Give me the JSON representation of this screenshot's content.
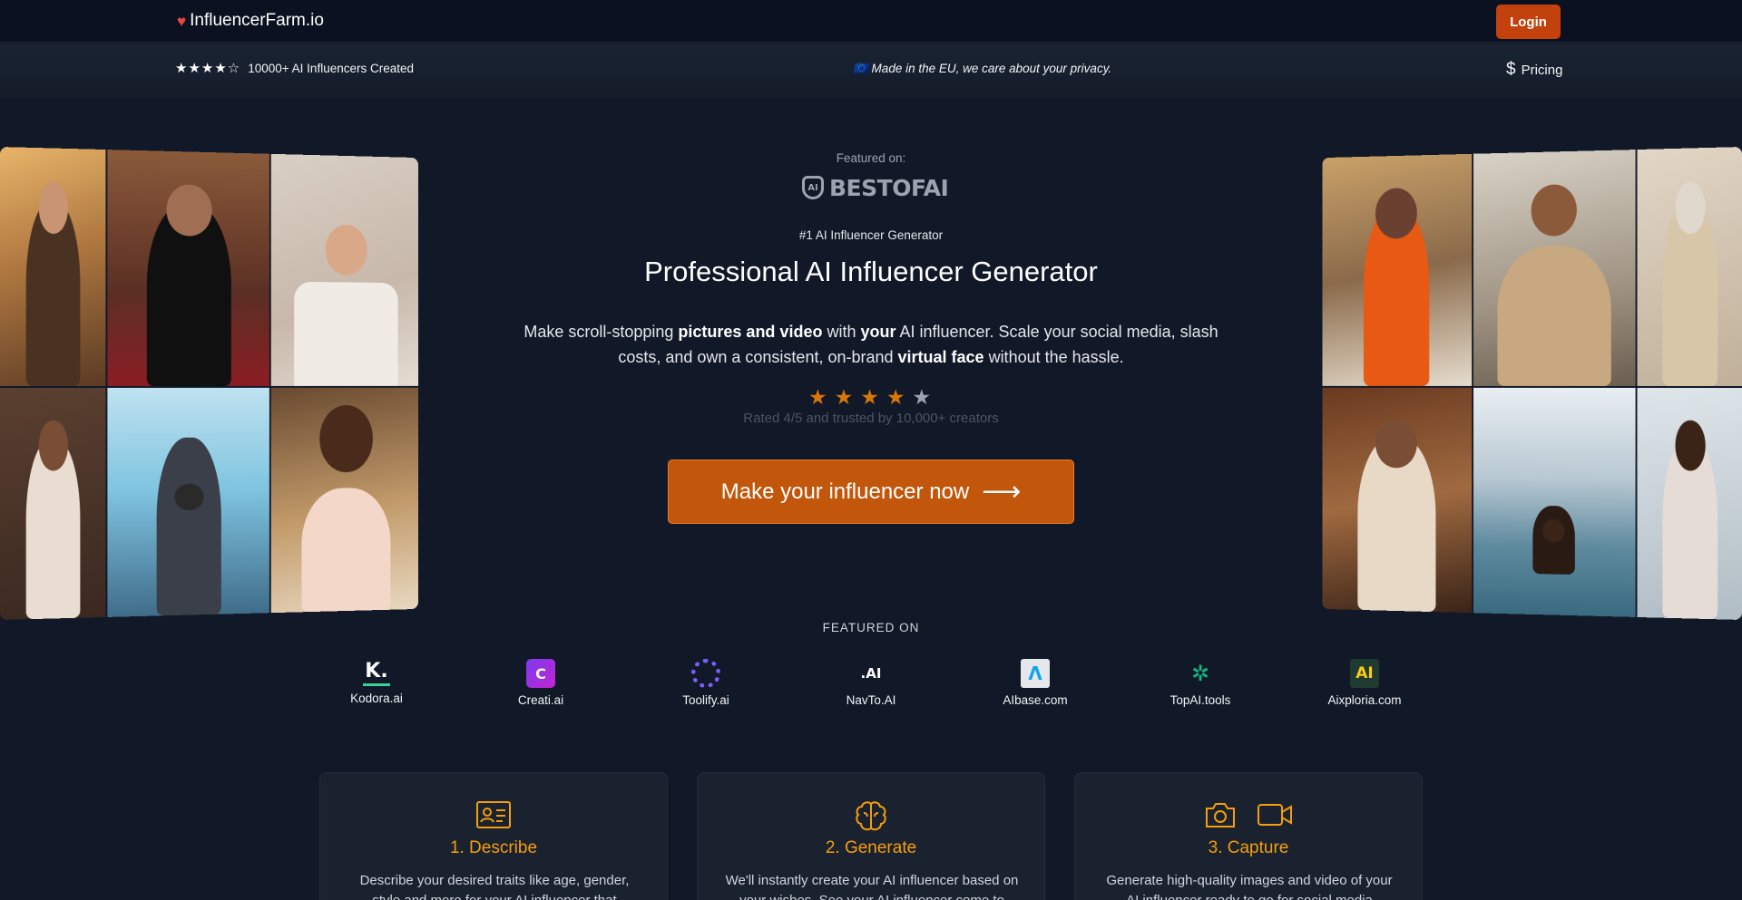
{
  "nav": {
    "brand": "InfluencerFarm.io",
    "login_label": "Login"
  },
  "subbar": {
    "stars": "★★★★☆",
    "creations": "10000+ AI Influencers Created",
    "privacy": "🇪🇺 Made in the EU, we care about your privacy.",
    "pricing_label": "Pricing"
  },
  "hero": {
    "featured_label": "Featured on:",
    "featured_logo": "BESTOFAI",
    "tagline": "#1 AI Influencer Generator",
    "title": "Professional AI Influencer Generator",
    "desc_parts": [
      "Make scroll-stopping ",
      "pictures and video",
      " with ",
      "your",
      " AI influencer. Scale your social media, slash costs, and own a consistent, on-brand ",
      "virtual face",
      " without the hassle."
    ],
    "rating_value": 4,
    "rating_max": 5,
    "rated_text": "Rated 4/5 and trusted by 10,000+ creators",
    "cta_label": "Make your influencer now"
  },
  "featured": {
    "heading": "FEATURED ON",
    "items": [
      {
        "name": "Kodora.ai",
        "mark": "K."
      },
      {
        "name": "Creati.ai",
        "mark": "C"
      },
      {
        "name": "Toolify.ai",
        "mark": ""
      },
      {
        "name": "NavTo.AI",
        "mark": ".AI"
      },
      {
        "name": "AIbase.com",
        "mark": "Λ"
      },
      {
        "name": "TopAI.tools",
        "mark": "✲"
      },
      {
        "name": "Aixploria.com",
        "mark": "AI"
      }
    ]
  },
  "steps": [
    {
      "title": "1. Describe",
      "desc": "Describe your desired traits like age, gender, style and more for your AI influencer that"
    },
    {
      "title": "2. Generate",
      "desc": "We'll instantly create your AI influencer based on your wishes. See your AI influencer come to"
    },
    {
      "title": "3. Capture",
      "desc": "Generate high-quality images and video of your AI influencer ready to go for social media"
    }
  ]
}
